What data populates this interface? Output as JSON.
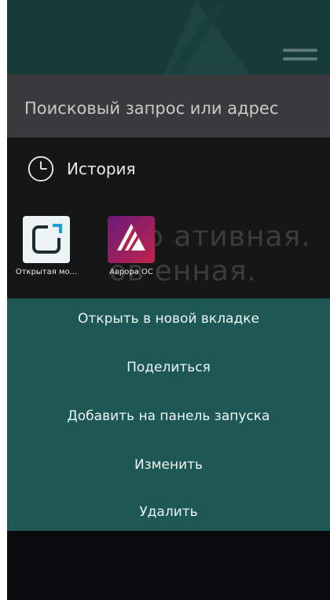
{
  "search": {
    "placeholder": "Поисковый запрос или адрес"
  },
  "history": {
    "label": "История",
    "icon": "clock-icon"
  },
  "tiles": [
    {
      "label": "Открытая мо...",
      "icon": "open-window-icon"
    },
    {
      "label": "Аврора ОС",
      "icon": "aurora-logo-icon"
    }
  ],
  "background_text": [
    "оро  ативная.",
    "ов  енная."
  ],
  "context_menu": {
    "items": [
      "Открыть в новой вкладке",
      "Поделиться",
      "Добавить на панель запуска",
      "Изменить",
      "Удалить"
    ]
  },
  "colors": {
    "header": "#163b38",
    "search_bar": "#3a3a3c",
    "menu_bg": "#1e5854",
    "screen_bg": "#0a0b0c"
  }
}
